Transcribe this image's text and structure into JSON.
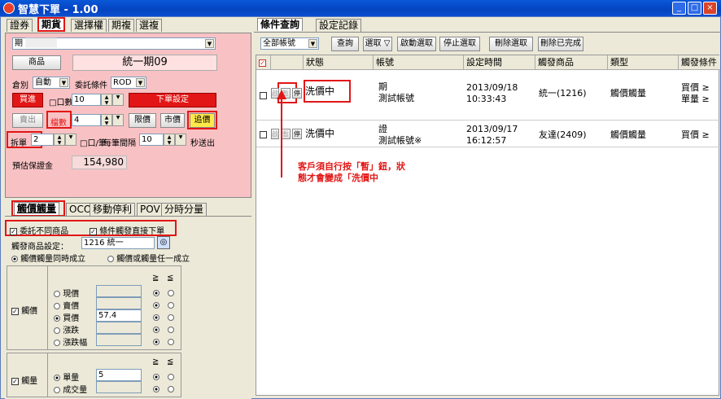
{
  "window": {
    "title": "智慧下單 - 1.00",
    "minimize": "_",
    "maximize": "□",
    "close": "×"
  },
  "left_tabs": [
    "證券",
    "期貨",
    "選擇權",
    "期複",
    "選複"
  ],
  "order": {
    "account_label": "期",
    "product_button": "商品",
    "product_name": "統一期09",
    "position_label": "倉別",
    "position_value": "自動",
    "condition_label": "委託條件",
    "condition_value": "ROD",
    "buy_button": "買進",
    "qty_label": "口數",
    "qty_value": "10",
    "order_settings_button": "下單設定",
    "sell_button": "賣出",
    "ticks_label": "檔數",
    "ticks_value": "4",
    "limit_button": "限價",
    "market_button": "市價",
    "chase_button": "追價",
    "split_label": "拆單",
    "split_value": "2",
    "per_lot_label": "口/筆",
    "interval_label": "每筆間隔",
    "interval_value": "10",
    "seconds_label": "秒送出",
    "margin_label": "預估保證金",
    "margin_value": "154,980"
  },
  "strategy_tabs": [
    "觸價觸量",
    "OCO",
    "移動停利",
    "POV",
    "分時分量"
  ],
  "trigger": {
    "diff_product_label": "委託不同商品",
    "direct_order_label": "條件觸發直接下單",
    "product_setting_label": "觸發商品設定：",
    "product_setting_value": "1216 統一",
    "mode_all": "觸價觸量同時成立",
    "mode_any": "觸價或觸量任一成立",
    "ge": "≧",
    "le": "≦",
    "price_group_label": "觸價",
    "price_options": [
      "現價",
      "賣價",
      "買價",
      "漲跌",
      "漲跌幅"
    ],
    "price_value": "57.4",
    "volume_group_label": "觸量",
    "volume_options": [
      "單量",
      "成交量"
    ],
    "volume_value": "5"
  },
  "right_tabs": [
    "條件查詢",
    "設定記錄"
  ],
  "toolbar": {
    "account_filter": "全部帳號",
    "query": "查詢",
    "select": "選取",
    "start_selected": "啟動選取",
    "stop_selected": "停止選取",
    "delete_selected": "刪除選取",
    "delete_done": "刪除已完成"
  },
  "grid": {
    "headers": [
      "狀態",
      "帳號",
      "設定時間",
      "觸發商品",
      "類型",
      "觸發條件"
    ],
    "rows": [
      {
        "status": "洗價中",
        "account1": "期",
        "account2": "測試帳號",
        "date": "2013/09/18",
        "time": "10:33:43",
        "product": "統一(1216)",
        "type": "觸價觸量",
        "cond1": "買價 ≥",
        "cond2": "單量 ≥"
      },
      {
        "status": "洗價中",
        "account1": "證",
        "account2": "測試帳號※",
        "date": "2013/09/17",
        "time": "16:12:57",
        "product": "友達(2409)",
        "type": "觸價觸量",
        "cond1": "買價 ≥ ",
        "cond2": ""
      }
    ],
    "btn_labels": [
      "啟",
      "暫",
      "停"
    ]
  },
  "annotation": {
    "line1": "客戶須自行按「暫」鈕，狀",
    "line2": "態才會變成「洗價中"
  }
}
